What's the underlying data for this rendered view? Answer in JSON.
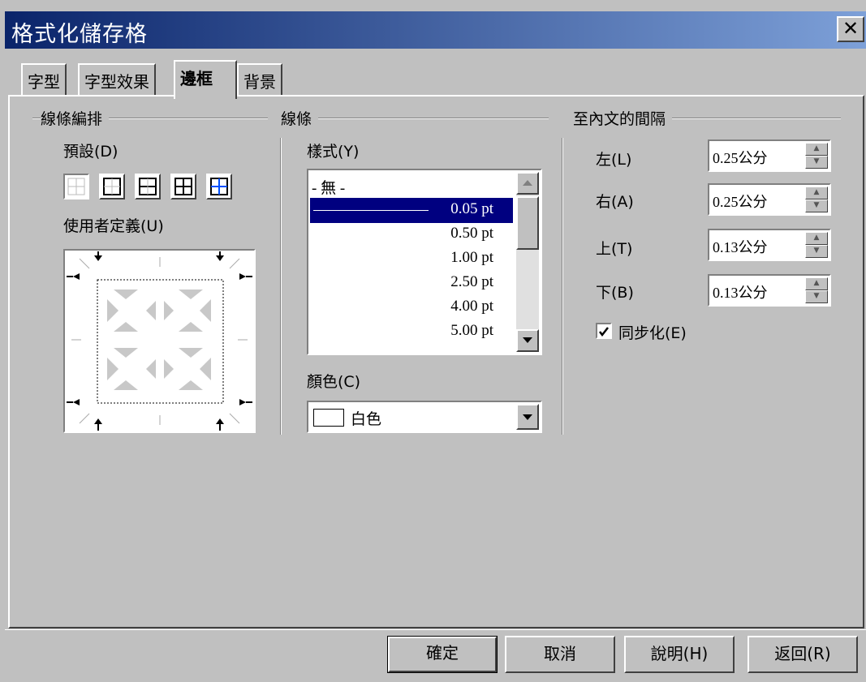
{
  "window": {
    "title": "格式化儲存格",
    "close_label": "✕"
  },
  "tabs": [
    {
      "label": "字型",
      "active": false
    },
    {
      "label": "字型效果",
      "active": false
    },
    {
      "label": "邊框",
      "active": true
    },
    {
      "label": "背景",
      "active": false
    }
  ],
  "line_arrangement": {
    "title": "線條編排",
    "default_label": "預設(D)",
    "user_defined_label": "使用者定義(U)",
    "presets": [
      "no-border-icon",
      "outer-border-icon",
      "outer-horizontal-icon",
      "outer-all-inner-icon",
      "outer-only-inner-icon"
    ]
  },
  "line": {
    "title": "線條",
    "style_label": "樣式(Y)",
    "styles": [
      {
        "label": "- 無 -",
        "selected": false
      },
      {
        "label": "0.05 pt",
        "selected": true
      },
      {
        "label": "0.50 pt",
        "selected": false
      },
      {
        "label": "1.00 pt",
        "selected": false
      },
      {
        "label": "2.50 pt",
        "selected": false
      },
      {
        "label": "4.00 pt",
        "selected": false
      },
      {
        "label": "5.00 pt",
        "selected": false
      }
    ],
    "color_label": "顏色(C)",
    "color_value": "白色",
    "selection_color": "#000080"
  },
  "spacing": {
    "title": "至內文的間隔",
    "left_label": "左(L)",
    "left_value": "0.25公分",
    "right_label": "右(A)",
    "right_value": "0.25公分",
    "top_label": "上(T)",
    "top_value": "0.13公分",
    "bottom_label": "下(B)",
    "bottom_value": "0.13公分",
    "sync_label": "同步化(E)",
    "sync_checked": true
  },
  "buttons": {
    "ok": "確定",
    "cancel": "取消",
    "help": "說明(H)",
    "reset": "返回(R)"
  },
  "theme": {
    "title_bar_start": "#0a246a",
    "title_bar_end": "#7da0d8",
    "face": "#c0c0c0"
  }
}
